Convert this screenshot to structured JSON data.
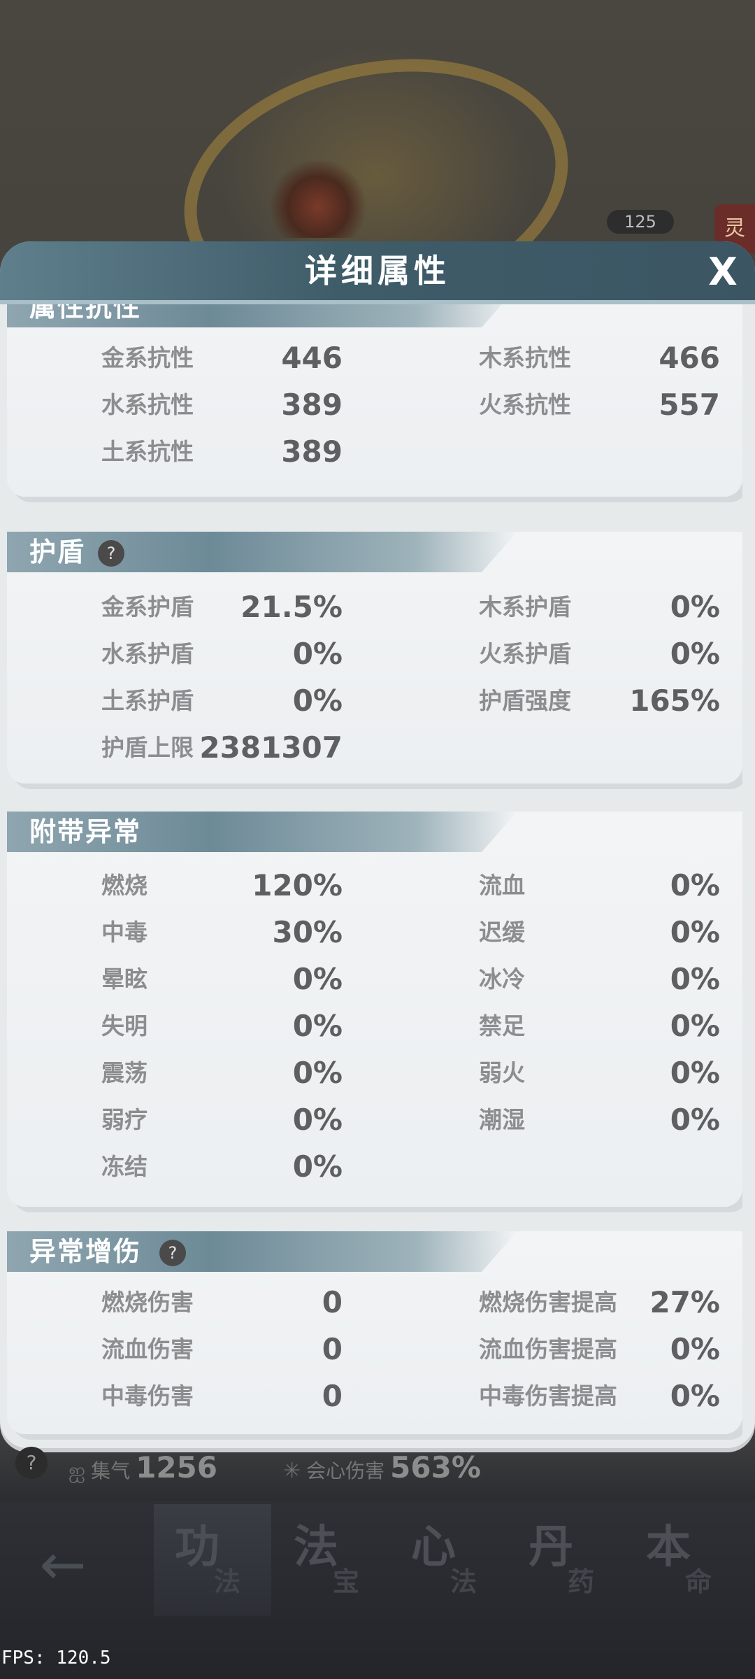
{
  "panel": {
    "title": "详细属性",
    "close_label": "X"
  },
  "background": {
    "level_badge": "125",
    "side_tag": "灵"
  },
  "sections": {
    "resist": {
      "title": "属性抗性",
      "items": [
        {
          "label": "金系抗性",
          "value": "446"
        },
        {
          "label": "木系抗性",
          "value": "466"
        },
        {
          "label": "水系抗性",
          "value": "389"
        },
        {
          "label": "火系抗性",
          "value": "557"
        },
        {
          "label": "土系抗性",
          "value": "389"
        }
      ]
    },
    "shield": {
      "title": "护盾",
      "help": "?",
      "items": [
        {
          "label": "金系护盾",
          "value": "21.5%"
        },
        {
          "label": "木系护盾",
          "value": "0%"
        },
        {
          "label": "水系护盾",
          "value": "0%"
        },
        {
          "label": "火系护盾",
          "value": "0%"
        },
        {
          "label": "土系护盾",
          "value": "0%"
        },
        {
          "label": "护盾强度",
          "value": "165%"
        },
        {
          "label": "护盾上限",
          "value": "2381307"
        }
      ]
    },
    "abnormal": {
      "title": "附带异常",
      "items": [
        {
          "label": "燃烧",
          "value": "120%"
        },
        {
          "label": "流血",
          "value": "0%"
        },
        {
          "label": "中毒",
          "value": "30%"
        },
        {
          "label": "迟缓",
          "value": "0%"
        },
        {
          "label": "晕眩",
          "value": "0%"
        },
        {
          "label": "冰冷",
          "value": "0%"
        },
        {
          "label": "失明",
          "value": "0%"
        },
        {
          "label": "禁足",
          "value": "0%"
        },
        {
          "label": "震荡",
          "value": "0%"
        },
        {
          "label": "弱火",
          "value": "0%"
        },
        {
          "label": "弱疗",
          "value": "0%"
        },
        {
          "label": "潮湿",
          "value": "0%"
        },
        {
          "label": "冻结",
          "value": "0%"
        }
      ]
    },
    "abn_damage": {
      "title": "异常增伤",
      "help": "?",
      "items": [
        {
          "label": "燃烧伤害",
          "value": "0"
        },
        {
          "label": "燃烧伤害提高",
          "value": "27%"
        },
        {
          "label": "流血伤害",
          "value": "0"
        },
        {
          "label": "流血伤害提高",
          "value": "0%"
        },
        {
          "label": "中毒伤害",
          "value": "0"
        },
        {
          "label": "中毒伤害提高",
          "value": "0%"
        }
      ]
    }
  },
  "stats_strip": {
    "help": "?",
    "qi_icon": "swirl-icon",
    "qi_label": "集气",
    "qi_value": "1256",
    "crit_icon": "star-burst-icon",
    "crit_label": "会心伤害",
    "crit_value": "563%"
  },
  "tabbar": {
    "back_icon": "back-arrow-icon",
    "tabs": [
      {
        "main": "功",
        "sub": "法"
      },
      {
        "main": "法",
        "sub": "宝"
      },
      {
        "main": "心",
        "sub": "法"
      },
      {
        "main": "丹",
        "sub": "药"
      },
      {
        "main": "本",
        "sub": "命"
      }
    ]
  },
  "fps": "FPS: 120.5"
}
